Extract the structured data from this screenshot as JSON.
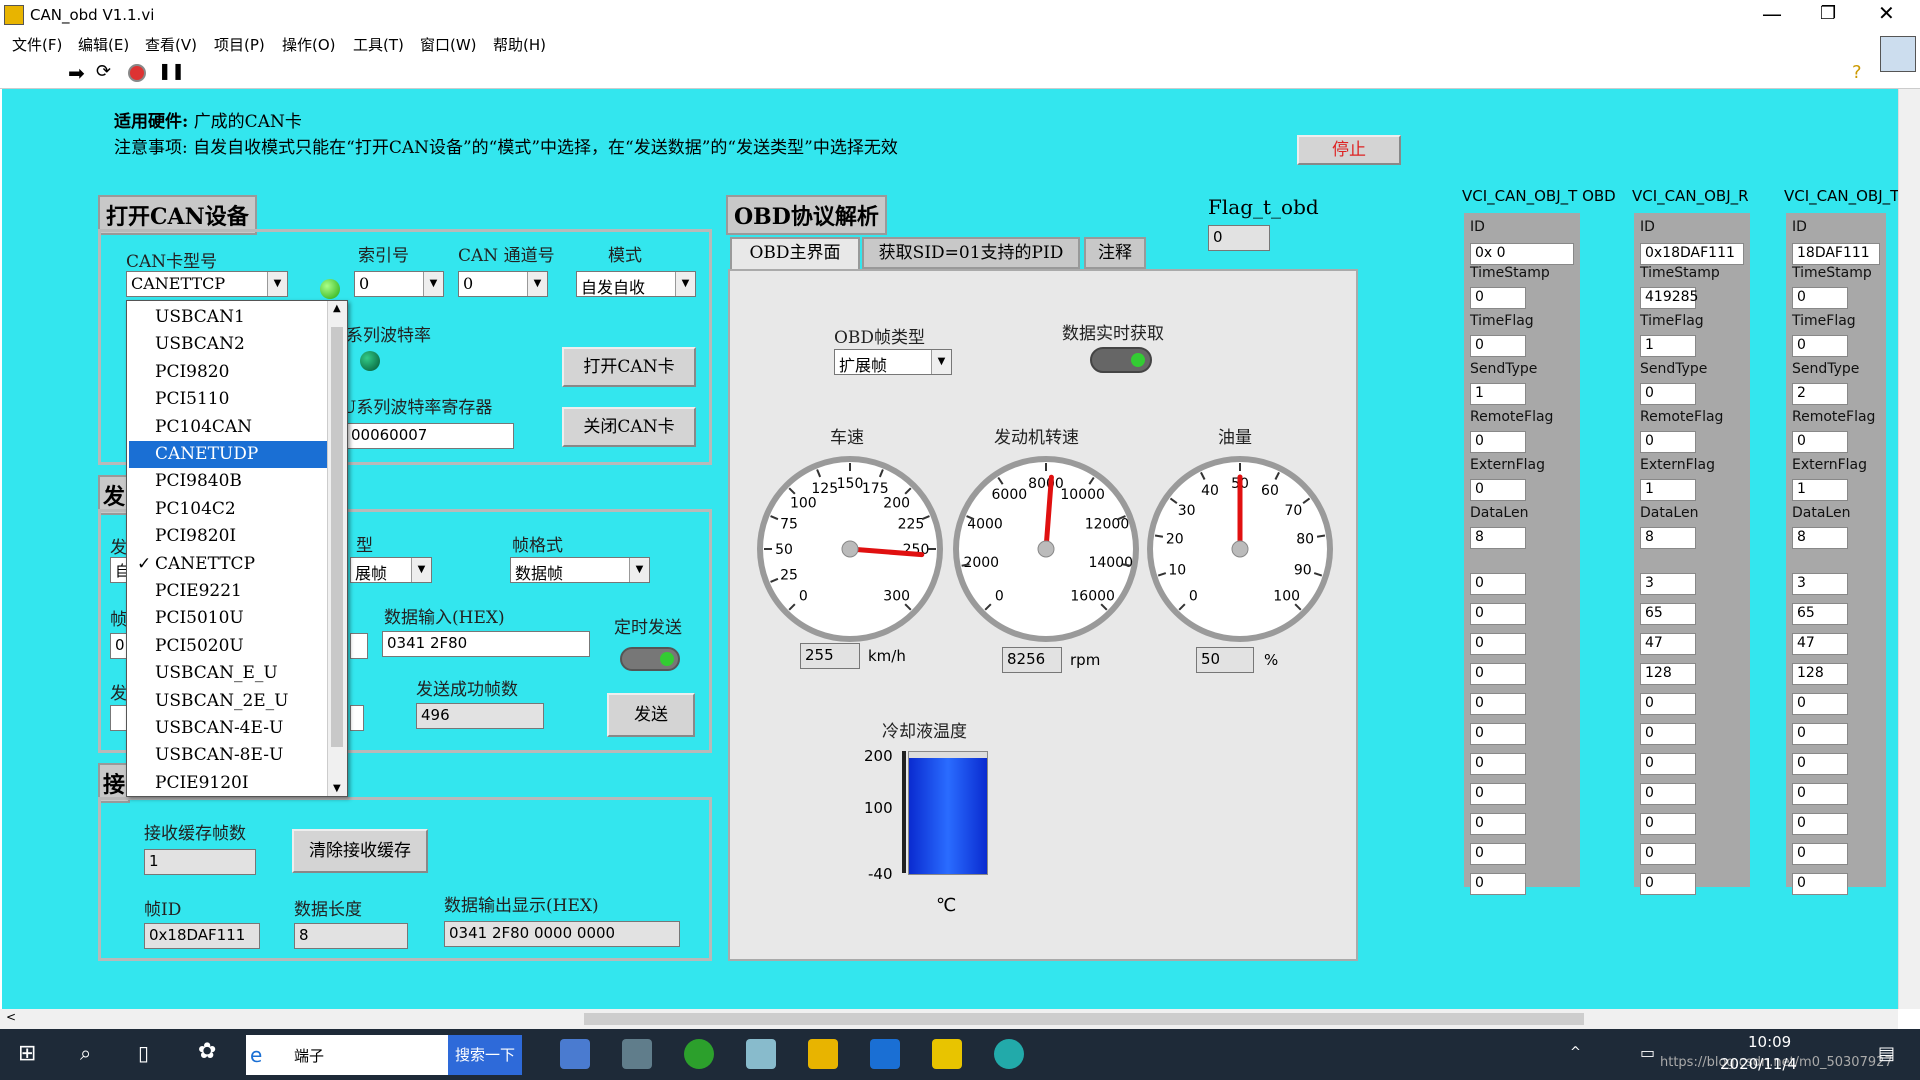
{
  "window": {
    "title": "CAN_obd V1.1.vi"
  },
  "menu": [
    "文件(F)",
    "编辑(E)",
    "查看(V)",
    "项目(P)",
    "操作(O)",
    "工具(T)",
    "窗口(W)",
    "帮助(H)"
  ],
  "header": {
    "hardware_label": "适用硬件:",
    "hardware_value": "广成的CAN卡",
    "note": "注意事项: 自发自收模式只能在“打开CAN设备”的“模式”中选择，在“发送数据”的“发送类型”中选择无效",
    "stop_button": "停止"
  },
  "open_can": {
    "title": "打开CAN设备",
    "card_type_label": "CAN卡型号",
    "card_type_value": "CANETTCP",
    "index_label": "索引号",
    "index_value": "0",
    "channel_label": "CAN 通道号",
    "channel_value": "0",
    "mode_label": "模式",
    "mode_value": "自发自收",
    "baud_label": "系列波特率",
    "baud_reg_label": "U系列波特率寄存器",
    "baud_reg_value": "00060007",
    "open_btn": "打开CAN卡",
    "close_btn": "关闭CAN卡"
  },
  "dropdown": {
    "items": [
      "USBCAN1",
      "USBCAN2",
      "PCI9820",
      "PCI5110",
      "PC104CAN",
      "CANETUDP",
      "PCI9840B",
      "PC104C2",
      "PCI9820I",
      "CANETTCP",
      "PCIE9221",
      "PCI5010U",
      "PCI5020U",
      "USBCAN_E_U",
      "USBCAN_2E_U",
      "USBCAN-4E-U",
      "USBCAN-8E-U",
      "PCIE9120I"
    ],
    "highlighted": "CANETUDP",
    "checked": "CANETTCP"
  },
  "send": {
    "title_partial": "发",
    "side_label_1": "发",
    "side_value_1": "自",
    "side_label_2": "帧",
    "side_value_2": "0",
    "side_label_3": "发",
    "type_label_partial": "型",
    "type_value_partial": "展帧",
    "frame_format_label": "帧格式",
    "frame_format_value": "数据帧",
    "data_input_label": "数据输入(HEX)",
    "data_input_value": "0341 2F80",
    "timed_send_label": "定时发送",
    "success_count_label": "发送成功帧数",
    "success_count_value": "496",
    "send_btn": "发送"
  },
  "receive": {
    "title_partial": "接",
    "buffer_label": "接收缓存帧数",
    "buffer_value": "1",
    "clear_btn": "清除接收缓存",
    "frame_id_label": "帧ID",
    "frame_id_value": "0x18DAF111",
    "data_len_label": "数据长度",
    "data_len_value": "8",
    "data_out_label": "数据输出显示(HEX)",
    "data_out_value": "0341 2F80 0000 0000"
  },
  "obd": {
    "title": "OBD协议解析",
    "flag_label": "Flag_t_obd",
    "flag_value": "0",
    "tabs": [
      "OBD主界面",
      "获取SID=01支持的PID",
      "注释"
    ],
    "frame_type_label": "OBD帧类型",
    "frame_type_value": "扩展帧",
    "realtime_label": "数据实时获取",
    "gauges": [
      {
        "label": "车速",
        "value": "255",
        "unit": "km/h",
        "ticks": [
          "0",
          "25",
          "50",
          "75",
          "100",
          "125",
          "150",
          "175",
          "200",
          "225",
          "250",
          "300"
        ]
      },
      {
        "label": "发动机转速",
        "value": "8256",
        "unit": "rpm",
        "ticks": [
          "0",
          "2000",
          "4000",
          "6000",
          "8000",
          "10000",
          "12000",
          "14000",
          "16000"
        ]
      },
      {
        "label": "油量",
        "value": "50",
        "unit": "%",
        "ticks": [
          "0",
          "10",
          "20",
          "30",
          "40",
          "50",
          "60",
          "70",
          "80",
          "90",
          "100"
        ]
      }
    ],
    "coolant": {
      "label": "冷却液温度",
      "unit": "℃",
      "ticks": [
        "200",
        "100",
        "-40"
      ],
      "level": 0.95
    }
  },
  "columns": [
    {
      "header": "VCI_CAN_OBJ_T OBD",
      "id": "0x    0",
      "timestamp": "0",
      "timeflag": "0",
      "sendtype": "1",
      "remoteflag": "0",
      "externflag": "0",
      "datalen": "8",
      "data": [
        "0",
        "0",
        "0",
        "0",
        "0",
        "0",
        "0",
        "0",
        "0",
        "0",
        "0"
      ]
    },
    {
      "header": "VCI_CAN_OBJ_R",
      "id": "0x18DAF111",
      "timestamp": "419285",
      "timeflag": "1",
      "sendtype": "0",
      "remoteflag": "0",
      "externflag": "1",
      "datalen": "8",
      "data": [
        "3",
        "65",
        "47",
        "128",
        "0",
        "0",
        "0",
        "0",
        "0",
        "0",
        "0"
      ]
    },
    {
      "header": "VCI_CAN_OBJ_T",
      "id": "18DAF111",
      "timestamp": "0",
      "timeflag": "0",
      "sendtype": "2",
      "remoteflag": "0",
      "externflag": "1",
      "datalen": "8",
      "data": [
        "3",
        "65",
        "47",
        "128",
        "0",
        "0",
        "0",
        "0",
        "0",
        "0",
        "0"
      ]
    }
  ],
  "field_names": {
    "id": "ID",
    "timestamp": "TimeStamp",
    "timeflag": "TimeFlag",
    "sendtype": "SendType",
    "remoteflag": "RemoteFlag",
    "externflag": "ExternFlag",
    "datalen": "DataLen"
  },
  "taskbar": {
    "search_text": "端子",
    "search_btn": "搜索一下",
    "time": "10:09",
    "date": "2020/11/4",
    "watermark": "https://blog.csdn.net/m0_50307927"
  }
}
